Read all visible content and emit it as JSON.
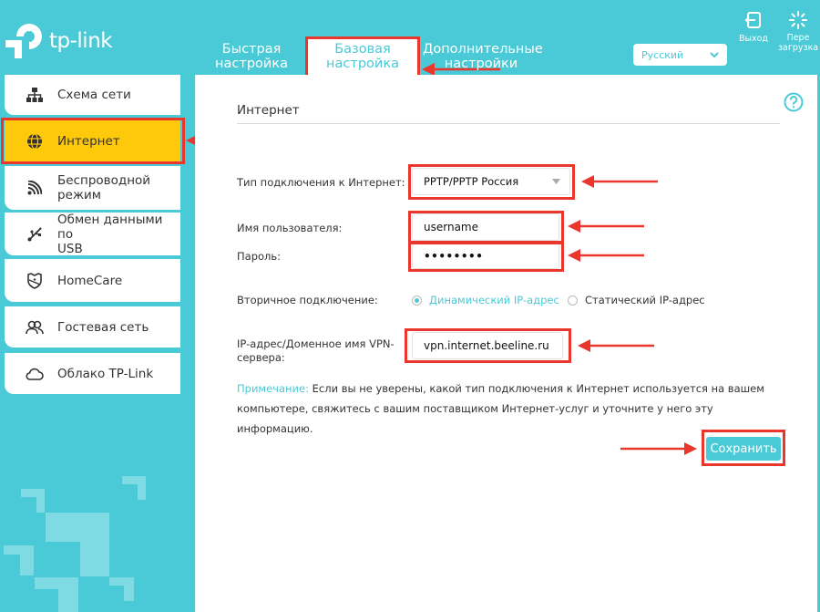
{
  "brand": {
    "name": "tp-link",
    "accent_color": "#4ac9d6",
    "highlight_color": "#ffc90b",
    "annotation_color": "#e9372e"
  },
  "header": {
    "tabs": [
      {
        "label_line1": "Быстрая",
        "label_line2": "настройка",
        "active": false
      },
      {
        "label_line1": "Базовая",
        "label_line2": "настройка",
        "active": true
      },
      {
        "label_line1": "Дополнительные",
        "label_line2": "настройки",
        "active": false
      }
    ],
    "language": {
      "selected": "Русский",
      "icon": "chevron-down-icon"
    },
    "logout": {
      "label": "Выход",
      "icon": "logout-icon"
    },
    "reboot": {
      "label_line1": "Пере",
      "label_line2": "загрузка",
      "icon": "reboot-icon"
    }
  },
  "sidebar": {
    "items": [
      {
        "label": "Схема сети",
        "icon": "network-map-icon",
        "active": false
      },
      {
        "label": "Интернет",
        "icon": "globe-icon",
        "active": true
      },
      {
        "label_line1": "Беспроводной",
        "label_line2": "режим",
        "icon": "wifi-icon",
        "active": false
      },
      {
        "label_line1": "Обмен данными по",
        "label_line2": "USB",
        "icon": "usb-icon",
        "active": false
      },
      {
        "label": "HomeCare",
        "icon": "shield-icon",
        "active": false
      },
      {
        "label": "Гостевая сеть",
        "icon": "guests-icon",
        "active": false
      },
      {
        "label": "Облако TP-Link",
        "icon": "cloud-icon",
        "active": false
      }
    ]
  },
  "main": {
    "title": "Интернет",
    "help_icon": "help-icon",
    "connection_type": {
      "label": "Тип подключения к Интернет:",
      "value": "PPTP/PPTP Россия"
    },
    "username": {
      "label": "Имя пользователя:",
      "value": "username"
    },
    "password": {
      "label": "Пароль:",
      "value": "••••••••"
    },
    "secondary": {
      "label": "Вторичное подключение:",
      "options": [
        {
          "label": "Динамический IP-адрес",
          "selected": true
        },
        {
          "label": "Статический IP-адрес",
          "selected": false
        }
      ]
    },
    "vpn_server": {
      "label_line1": "IP-адрес/Доменное имя VPN-",
      "label_line2": "сервера:",
      "value": "vpn.internet.beeline.ru"
    },
    "note": {
      "label": "Примечание:",
      "text": "Если вы не уверены, какой тип подключения к Интернет используется на вашем компьютере, свяжитесь с вашим поставщиком Интернет-услуг и уточните у него эту информацию."
    },
    "save_label": "Сохранить"
  }
}
